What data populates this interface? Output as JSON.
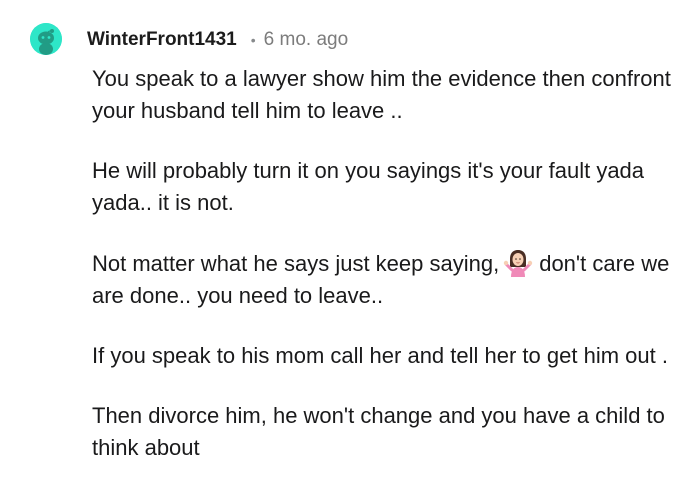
{
  "comment": {
    "author": {
      "username": "WinterFront1431",
      "avatar_icon": "snoo-avatar-icon",
      "avatar_color": "#2ee6c8"
    },
    "separator": "•",
    "age": "6 mo. ago",
    "paragraphs": [
      "You speak to a lawyer show him the evidence then confront your husband tell him to leave ..",
      "He will probably turn it on you sayings it's your fault yada yada.. it is not.",
      {
        "before": "Not matter what he says just keep saying,",
        "emoji": "woman-shrugging-emoji",
        "after": "don't care we are done.. you need to leave.."
      },
      "If you speak to his mom call her and tell her to get him out .",
      "Then divorce him, he won't change and you have a child to think about"
    ]
  }
}
